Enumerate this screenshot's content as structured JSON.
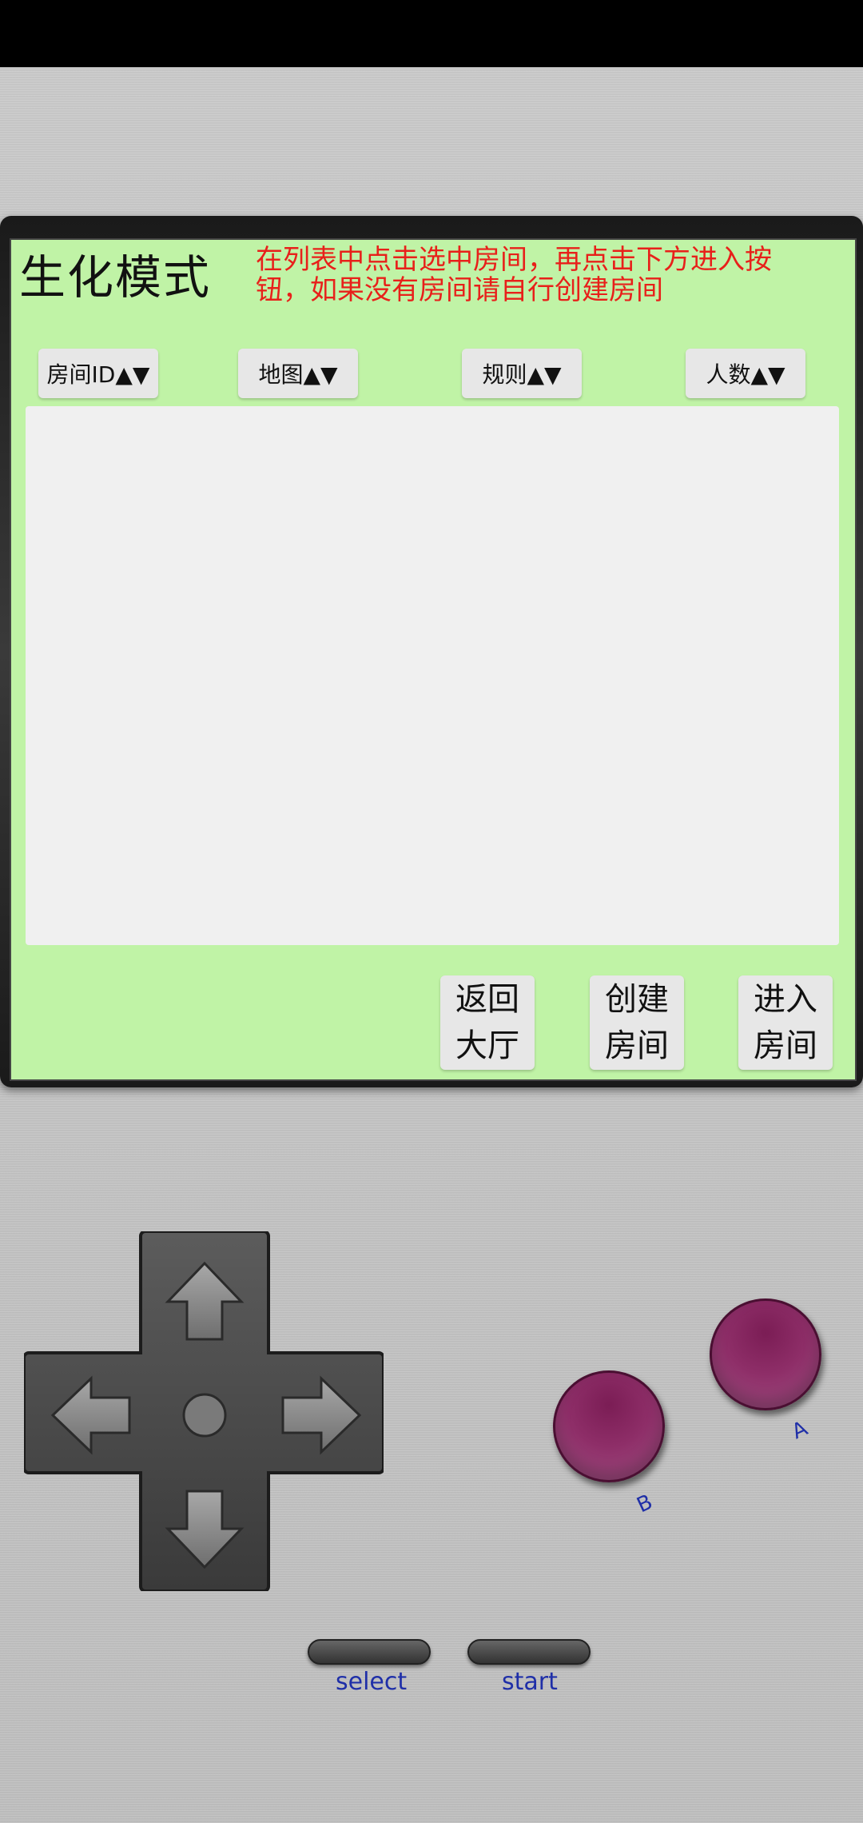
{
  "screen": {
    "mode_title": "生化模式",
    "hint": "在列表中点击选中房间，再点击下方进入按钮，如果没有房间请自行创建房间",
    "sort_buttons": [
      "房间ID▲▼",
      "地图▲▼",
      "规则▲▼",
      "人数▲▼"
    ],
    "actions": {
      "back": [
        "返回",
        "大厅"
      ],
      "create": [
        "创建",
        "房间"
      ],
      "enter": [
        "进入",
        "房间"
      ]
    }
  },
  "controls": {
    "a_label": "A",
    "b_label": "B",
    "select_label": "select",
    "start_label": "start"
  },
  "colors": {
    "screen_bg": "#c0f3a6",
    "hint_red": "#e8201a",
    "button_magenta": "#8e2e68",
    "label_blue": "#1f2fa8"
  },
  "icons": {
    "dpad": [
      "arrow-up-icon",
      "arrow-down-icon",
      "arrow-left-icon",
      "arrow-right-icon"
    ]
  }
}
